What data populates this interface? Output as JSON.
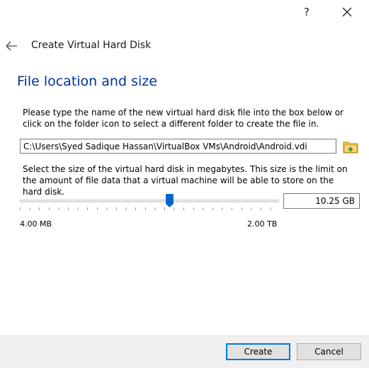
{
  "titlebar": {
    "help_label": "?"
  },
  "header": {
    "title": "Create Virtual Hard Disk"
  },
  "page": {
    "title": "File location and size"
  },
  "location": {
    "instructions": "Please type the name of the new virtual hard disk file into the box below or click on the folder icon to select a different folder to create the file in.",
    "path": "C:\\Users\\Syed Sadique Hassan\\VirtualBox VMs\\Android\\Android.vdi"
  },
  "size": {
    "instructions": "Select the size of the virtual hard disk in megabytes. This size is the limit on the amount of file data that a virtual machine will be able to store on the hard disk.",
    "value": "10.25 GB",
    "slider_fraction": 0.58,
    "min_label": "4.00 MB",
    "max_label": "2.00 TB"
  },
  "buttons": {
    "create": "Create",
    "cancel": "Cancel"
  },
  "colors": {
    "title": "#003399",
    "accent": "#0078d7",
    "slider_thumb": "#0a64c8"
  },
  "icons": {
    "back": "arrow-left-icon",
    "close": "close-icon",
    "folder": "folder-icon"
  }
}
